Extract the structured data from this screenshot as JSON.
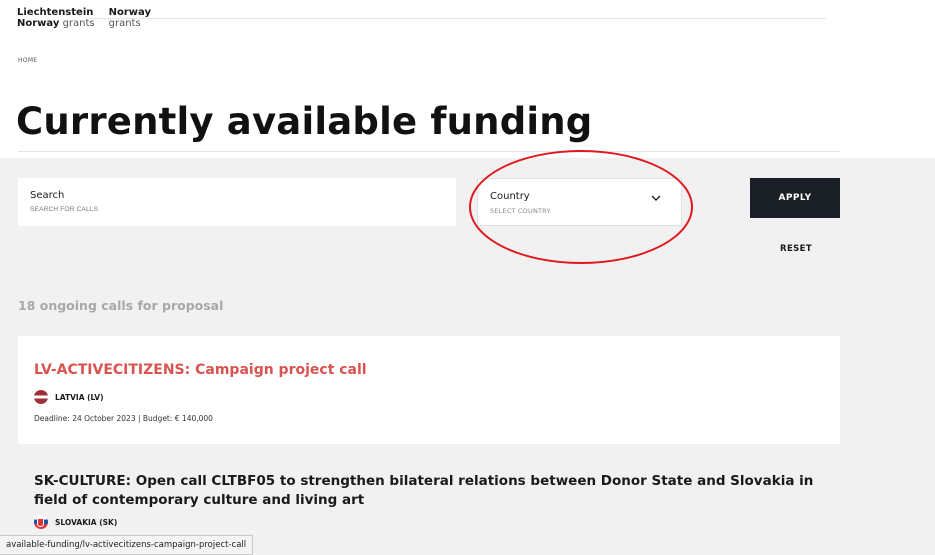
{
  "brand": {
    "col1_line1": "Liechtenstein",
    "col1_line2_bold": "Norway",
    "col1_line2_rest": "grants",
    "col2_line1": "Norway",
    "col2_line2": "grants"
  },
  "breadcrumb": "HOME",
  "page_title": "Currently available funding",
  "filters": {
    "search_label": "Search",
    "search_placeholder": "SEARCH FOR CALLS",
    "country_label": "Country",
    "country_placeholder": "SELECT COUNTRY",
    "apply_label": "APPLY",
    "reset_label": "RESET"
  },
  "results": {
    "count_text": "18 ongoing calls for proposal",
    "items": [
      {
        "title": "LV-ACTIVECITIZENS: Campaign project call",
        "country": "LATVIA (LV)",
        "meta": "Deadline: 24 October 2023 | Budget: € 140,000"
      },
      {
        "title": "SK-CULTURE: Open call CLTBF05 to strengthen bilateral relations between Donor State and Slovakia in field of contemporary culture and living art",
        "country": "SLOVAKIA (SK)"
      }
    ]
  },
  "status_bar_url": "available-funding/lv-activecitizens-campaign-project-call",
  "colors": {
    "accent_red": "#d9534f",
    "apply_bg": "#1b1f26",
    "annotation_red": "#e0171d",
    "section_gray": "#f1f1f1"
  },
  "icons": {
    "country_dropdown": "chevron-down-icon",
    "flag_latvia": "latvia-flag-icon",
    "flag_slovakia": "slovakia-flag-icon"
  }
}
